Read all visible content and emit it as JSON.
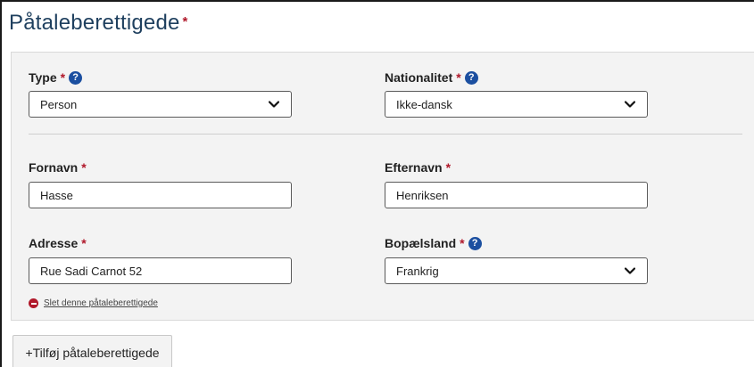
{
  "section": {
    "title": "Påtaleberettigede",
    "required_marker": "*"
  },
  "form": {
    "type": {
      "label": "Type",
      "required": "*",
      "help_icon": "question-circle-icon",
      "selected": "Person"
    },
    "nationality": {
      "label": "Nationalitet",
      "required": "*",
      "help_icon": "question-circle-icon",
      "selected": "Ikke-dansk"
    },
    "first_name": {
      "label": "Fornavn",
      "required": "*",
      "value": "Hasse"
    },
    "last_name": {
      "label": "Efternavn",
      "required": "*",
      "value": "Henriksen"
    },
    "address": {
      "label": "Adresse",
      "required": "*",
      "value": "Rue Sadi Carnot 52"
    },
    "country": {
      "label": "Bopælsland",
      "required": "*",
      "help_icon": "question-circle-icon",
      "selected": "Frankrig"
    }
  },
  "actions": {
    "delete_label": "Slet denne påtaleberettigede",
    "add_label": "+Tilføj påtaleberettigede"
  },
  "colors": {
    "title": "#1e3f5e",
    "required": "#b0182a",
    "help_icon": "#1b4fa0",
    "panel_bg": "#f3f3f3"
  }
}
